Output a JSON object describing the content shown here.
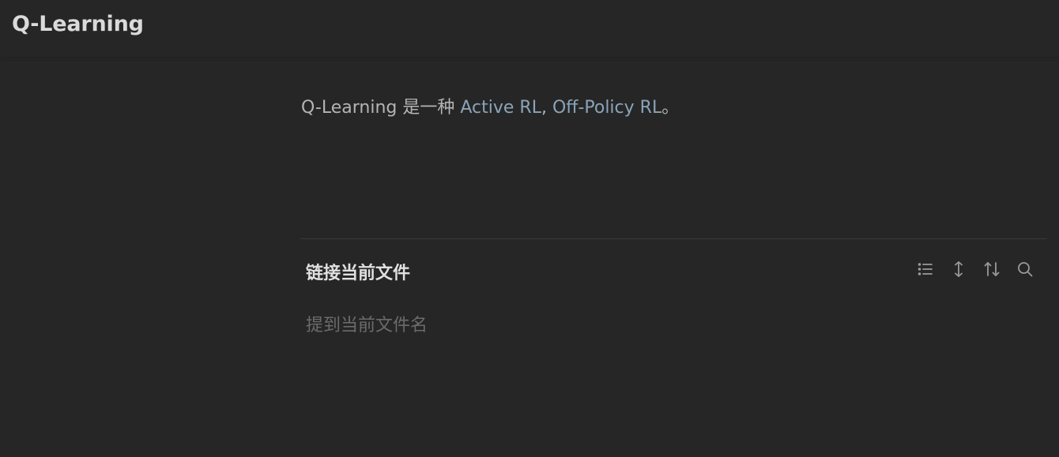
{
  "header": {
    "title": "Q-Learning"
  },
  "note": {
    "text_prefix": "Q-Learning 是一种 ",
    "link1": "Active RL",
    "separator": ", ",
    "link2": "Off-Policy RL",
    "text_suffix": "。"
  },
  "backlinks": {
    "title": "链接当前文件",
    "empty_text": "提到当前文件名",
    "toolbar": {
      "icons": [
        "list-icon",
        "expand-vertical-icon",
        "sort-icon",
        "search-icon"
      ]
    }
  },
  "colors": {
    "background": "#262626",
    "link": "#8aa4b8",
    "body_text": "#b4b4b4",
    "muted_text": "#6b6b6b",
    "icon": "#9a9a9a"
  }
}
